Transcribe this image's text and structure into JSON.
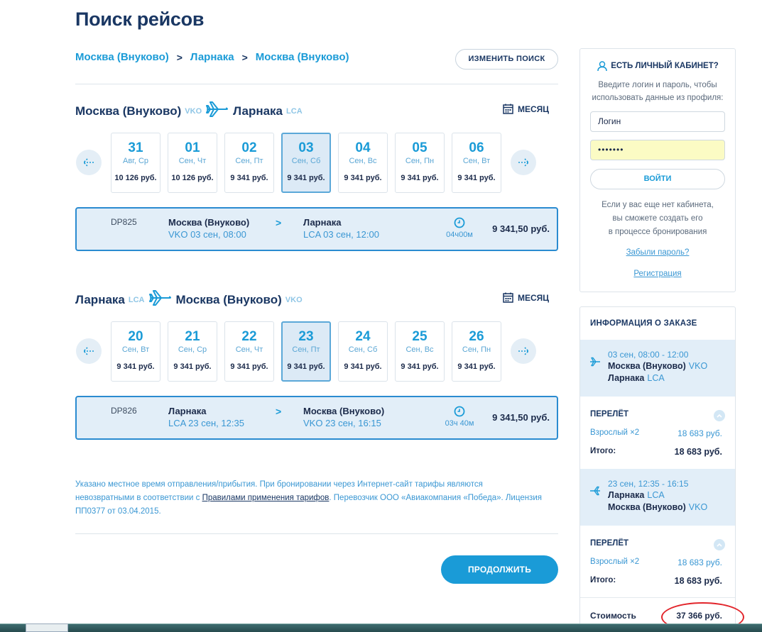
{
  "page": {
    "title": "Поиск рейсов"
  },
  "breadcrumb": [
    "Москва (Внуково)",
    "Ларнака",
    "Москва (Внуково)"
  ],
  "change_search_label": "ИЗМЕНИТЬ ПОИСК",
  "month_label": "МЕСЯЦ",
  "outbound": {
    "from_city": "Москва (Внуково)",
    "from_code": "VKO",
    "to_city": "Ларнака",
    "to_code": "LCA",
    "dates": [
      {
        "day": "31",
        "dow": "Авг, Ср",
        "price": "10 126 руб."
      },
      {
        "day": "01",
        "dow": "Сен, Чт",
        "price": "10 126 руб."
      },
      {
        "day": "02",
        "dow": "Сен, Пт",
        "price": "9 341 руб."
      },
      {
        "day": "03",
        "dow": "Сен, Сб",
        "price": "9 341 руб."
      },
      {
        "day": "04",
        "dow": "Сен, Вс",
        "price": "9 341 руб."
      },
      {
        "day": "05",
        "dow": "Сен, Пн",
        "price": "9 341 руб."
      },
      {
        "day": "06",
        "dow": "Сен, Вт",
        "price": "9 341 руб."
      }
    ],
    "selected_index": 3,
    "flight": {
      "number": "DP825",
      "dep_city": "Москва (Внуково)",
      "dep_time": "VKO 03 сен, 08:00",
      "arr_city": "Ларнака",
      "arr_time": "LCA 03 сен, 12:00",
      "duration": "04ч00м",
      "price": "9 341,50 руб."
    }
  },
  "inbound": {
    "from_city": "Ларнака",
    "from_code": "LCA",
    "to_city": "Москва (Внуково)",
    "to_code": "VKO",
    "dates": [
      {
        "day": "20",
        "dow": "Сен, Вт",
        "price": "9 341 руб."
      },
      {
        "day": "21",
        "dow": "Сен, Ср",
        "price": "9 341 руб."
      },
      {
        "day": "22",
        "dow": "Сен, Чт",
        "price": "9 341 руб."
      },
      {
        "day": "23",
        "dow": "Сен, Пт",
        "price": "9 341 руб."
      },
      {
        "day": "24",
        "dow": "Сен, Сб",
        "price": "9 341 руб."
      },
      {
        "day": "25",
        "dow": "Сен, Вс",
        "price": "9 341 руб."
      },
      {
        "day": "26",
        "dow": "Сен, Пн",
        "price": "9 341 руб."
      }
    ],
    "selected_index": 3,
    "flight": {
      "number": "DP826",
      "dep_city": "Ларнака",
      "dep_time": "LCA 23 сен, 12:35",
      "arr_city": "Москва (Внуково)",
      "arr_time": "VKO 23 сен, 16:15",
      "duration": "03ч 40м",
      "price": "9 341,50 руб."
    }
  },
  "note": {
    "text_before": "Указано местное время отправления/прибытия. При бронировании через Интернет-сайт тарифы являются невозвратными в соответствии с ",
    "link": "Правилами применения тарифов",
    "text_after": ". Перевозчик ООО «Авиакомпания «Победа». Лицензия ПП0377 от 03.04.2015."
  },
  "continue_label": "ПРОДОЛЖИТЬ",
  "login": {
    "title": "ЕСТЬ ЛИЧНЫЙ КАБИНЕТ?",
    "subtitle_1": "Введите логин и пароль, чтобы",
    "subtitle_2": "использовать данные из профиля:",
    "login_value": "Логин",
    "password_value": "•••••••",
    "submit_label": "ВОЙТИ",
    "note_1": "Если у вас еще нет кабинета,",
    "note_2": "вы сможете создать его",
    "note_3": "в процессе бронирования",
    "forgot_link": "Забыли пароль?",
    "register_link": "Регистрация"
  },
  "order": {
    "title": "ИНФОРМАЦИЯ О ЗАКАЗЕ",
    "segment1": {
      "time": "03 сен, 08:00 - 12:00",
      "from_city": "Москва (Внуково)",
      "from_code": "VKO",
      "to_city": "Ларнака",
      "to_code": "LCA"
    },
    "fare1": {
      "title": "ПЕРЕЛЁТ",
      "adult_label": "Взрослый ×2",
      "adult_value": "18 683 руб.",
      "total_label": "Итого:",
      "total_value": "18 683 руб."
    },
    "segment2": {
      "time": "23 сен, 12:35 - 16:15",
      "from_city": "Ларнака",
      "from_code": "LCA",
      "to_city": "Москва (Внуково)",
      "to_code": "VKO"
    },
    "fare2": {
      "title": "ПЕРЕЛЁТ",
      "adult_label": "Взрослый ×2",
      "adult_value": "18 683 руб.",
      "total_label": "Итого:",
      "total_value": "18 683 руб."
    },
    "cost_label": "Стоимость",
    "cost_value": "37 366 руб."
  },
  "colors": {
    "brand_blue": "#1a9bd7",
    "navy": "#1a3763",
    "annotation_red": "#e2252b"
  }
}
